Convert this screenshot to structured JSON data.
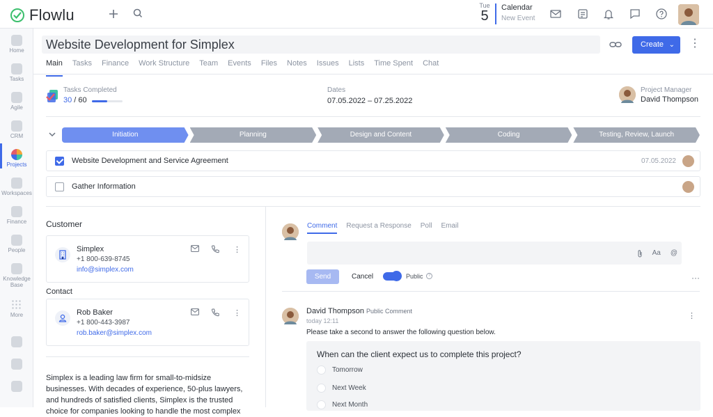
{
  "app": {
    "brand": "Flowlu"
  },
  "calendar": {
    "day_name": "Tue",
    "day_number": "5",
    "label": "Calendar",
    "sub": "New Event"
  },
  "sidebar": {
    "items": [
      {
        "label": "Home"
      },
      {
        "label": "Tasks"
      },
      {
        "label": "Agile"
      },
      {
        "label": "CRM"
      },
      {
        "label": "Projects"
      },
      {
        "label": "Workspaces"
      },
      {
        "label": "Finance"
      },
      {
        "label": "People"
      },
      {
        "label": "Knowledge Base"
      },
      {
        "label": "More"
      }
    ]
  },
  "project": {
    "title": "Website Development for Simplex",
    "create_label": "Create"
  },
  "tabs": [
    "Main",
    "Tasks",
    "Finance",
    "Work Structure",
    "Team",
    "Events",
    "Files",
    "Notes",
    "Issues",
    "Lists",
    "Time Spent",
    "Chat"
  ],
  "stats": {
    "tasks_label": "Tasks Completed",
    "tasks_done": "30",
    "tasks_total": "60",
    "tasks_sep": " / ",
    "progress_fraction": 0.5,
    "dates_label": "Dates",
    "dates_value": "07.05.2022  –  07.25.2022",
    "pm_label": "Project Manager",
    "pm_name": "David Thompson"
  },
  "stages": [
    {
      "label": "Initiation",
      "active": true
    },
    {
      "label": "Planning",
      "active": false
    },
    {
      "label": "Design and Content",
      "active": false
    },
    {
      "label": "Coding",
      "active": false
    },
    {
      "label": "Testing, Review, Launch",
      "active": false
    }
  ],
  "task_rows": [
    {
      "name": "Website Development and Service Agreement",
      "date": "07.05.2022",
      "checked": true
    },
    {
      "name": "Gather Information",
      "date": "",
      "checked": false
    }
  ],
  "customer": {
    "section": "Customer",
    "name": "Simplex",
    "phone": "+1 800-639-8745",
    "email": "info@simplex.com"
  },
  "contact": {
    "section": "Contact",
    "name": "Rob Baker",
    "phone": "+1 800-443-3987",
    "email": "rob.baker@simplex.com"
  },
  "description": "Simplex is a leading law firm for small-to-midsize businesses. With decades of experience, 50-plus lawyers, and hundreds of satisfied clients, Simplex is the trusted choice for companies looking to handle the most complex",
  "comments": {
    "tabs": [
      "Comment",
      "Request a Response",
      "Poll",
      "Email"
    ],
    "send_label": "Send",
    "cancel_label": "Cancel",
    "public_label": "Public",
    "format_label": "Aa",
    "mention_label": "@"
  },
  "post": {
    "author": "David Thompson",
    "kind": "Public Comment",
    "time": "today 12:11",
    "text": "Please take a second to answer the following question below.",
    "poll_question": "When can the client expect us to complete this project?",
    "options": [
      "Tomorrow",
      "Next Week",
      "Next Month"
    ]
  },
  "colors": {
    "accent": "#3f6ae8",
    "stage_active": "#6f8ff0",
    "stage_inactive": "#a3aab6"
  },
  "icons": [
    "plus-icon",
    "search-icon",
    "mail-icon",
    "notes-icon",
    "bell-icon",
    "chat-icon",
    "help-icon",
    "link-icon",
    "more-icon",
    "attach-icon",
    "phone-icon",
    "building-icon",
    "user-icon"
  ]
}
